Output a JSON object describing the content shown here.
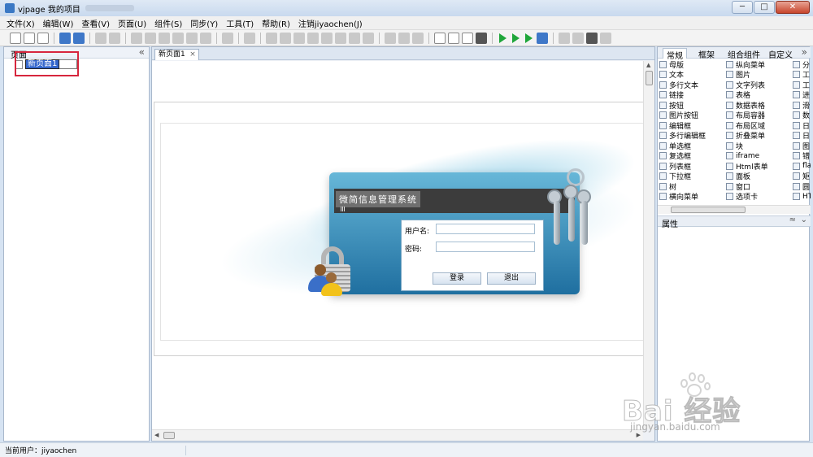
{
  "window": {
    "title": "vjpage 我的项目",
    "min_label": "─",
    "max_label": "□",
    "close_label": "✕"
  },
  "menu": [
    "文件(X)",
    "编辑(W)",
    "查看(V)",
    "页面(U)",
    "组件(S)",
    "同步(Y)",
    "工具(T)",
    "帮助(R)",
    "注销jiyaochen(J)"
  ],
  "left_pane": {
    "header": "页面",
    "collapse_glyph": "«",
    "page_node_label": "新页面1"
  },
  "editor": {
    "tab_label": "新页面1",
    "tab_close": "×",
    "login": {
      "system_title": "微简信息管理系统",
      "username_label": "用户名:",
      "password_label": "密码:",
      "login_button": "登录",
      "exit_button": "退出"
    }
  },
  "components": {
    "tabs": [
      "常规",
      "框架",
      "组合组件",
      "自定义"
    ],
    "more_glyph": "»",
    "col1": [
      "母版",
      "文本",
      "多行文本",
      "链接",
      "按钮",
      "图片按钮",
      "编辑框",
      "多行编辑框",
      "单选框",
      "复选框",
      "列表框",
      "下拉框",
      "树",
      "横向菜单"
    ],
    "col2": [
      "纵向菜单",
      "图片",
      "文字列表",
      "表格",
      "数据表格",
      "布局容器",
      "布局区域",
      "折叠菜单",
      "块",
      "iframe",
      "Html表单",
      "面板",
      "窗口",
      "选项卡"
    ],
    "col3": [
      "分",
      "工",
      "工",
      "进",
      "滑",
      "数",
      "日",
      "日",
      "图",
      "错",
      "fla",
      "矩",
      "圆",
      "HT"
    ]
  },
  "properties": {
    "header": "属性",
    "chevron": "≈",
    "chevron2": "⌄"
  },
  "status": {
    "current_user": "当前用户：jiyaochen"
  },
  "watermark": {
    "logo": "Bai  经验",
    "url": "jingyan.baidu.com"
  },
  "colors": {
    "accent": "#3366cc",
    "highlight_box": "#d7263d",
    "run_green": "#1fa63a"
  }
}
